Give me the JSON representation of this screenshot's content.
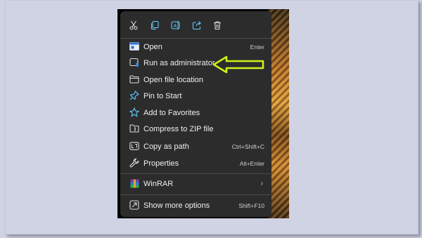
{
  "toolbar": {
    "icons": [
      "cut-icon",
      "copy-icon",
      "rename-icon",
      "share-icon",
      "delete-icon"
    ]
  },
  "menu": {
    "items": [
      {
        "label": "Open",
        "shortcut": "Enter",
        "icon": "open-icon"
      },
      {
        "label": "Run as administrator",
        "shortcut": "",
        "icon": "shield-icon"
      },
      {
        "label": "Open file location",
        "shortcut": "",
        "icon": "folder-icon"
      },
      {
        "label": "Pin to Start",
        "shortcut": "",
        "icon": "pin-icon"
      },
      {
        "label": "Add to Favorites",
        "shortcut": "",
        "icon": "star-icon"
      },
      {
        "label": "Compress to ZIP file",
        "shortcut": "",
        "icon": "zip-icon"
      },
      {
        "label": "Copy as path",
        "shortcut": "Ctrl+Shift+C",
        "icon": "path-icon"
      },
      {
        "label": "Properties",
        "shortcut": "Alt+Enter",
        "icon": "wrench-icon"
      },
      {
        "label": "WinRAR",
        "shortcut": "",
        "icon": "winrar-icon"
      },
      {
        "label": "Show more options",
        "shortcut": "Shift+F10",
        "icon": "more-options-icon"
      }
    ]
  },
  "colors": {
    "page_bg": "#d0d3e3",
    "menu_bg": "#2c2c2c",
    "accent": "#60cdff",
    "annotation": "#c9f21a"
  }
}
